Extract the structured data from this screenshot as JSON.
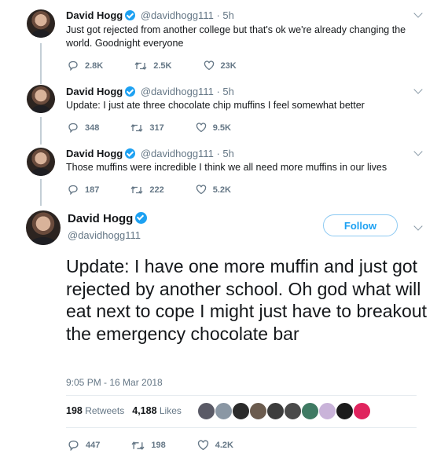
{
  "tweets": [
    {
      "name": "David Hogg",
      "handle": "@davidhogg111",
      "time": "· 5h",
      "text": "Just got rejected from another college but that's ok we're already changing the world. Goodnight everyone",
      "replies": "2.8K",
      "retweets": "2.5K",
      "likes": "23K"
    },
    {
      "name": "David Hogg",
      "handle": "@davidhogg111",
      "time": "· 5h",
      "text": "Update: I just ate three chocolate chip muffins I feel somewhat better",
      "replies": "348",
      "retweets": "317",
      "likes": "9.5K"
    },
    {
      "name": "David Hogg",
      "handle": "@davidhogg111",
      "time": "· 5h",
      "text": "Those muffins were incredible I think we all need more muffins in our lives",
      "replies": "187",
      "retweets": "222",
      "likes": "5.2K"
    }
  ],
  "main": {
    "name": "David Hogg",
    "handle": "@davidhogg111",
    "follow_label": "Follow",
    "text": "Update: I have one more muffin and just got rejected by another school. Oh god what will eat next to cope I might just have to breakout the emergency chocolate bar",
    "timestamp": "9:05 PM - 16 Mar 2018",
    "retweets_count": "198",
    "retweets_label": "Retweets",
    "likes_count": "4,188",
    "likes_label": "Likes",
    "replies": "447",
    "retweets": "198",
    "likes": "4.2K"
  },
  "colors": {
    "accent": "#1da1f2",
    "muted": "#657786",
    "text": "#14171a"
  },
  "liker_colors": [
    "#5a5a66",
    "#8a97a4",
    "#2b2b2b",
    "#6b5b4e",
    "#3c3c3c",
    "#4a4a4a",
    "#3f7a63",
    "#c9b3d9",
    "#1c1c1c",
    "#e0245e"
  ]
}
